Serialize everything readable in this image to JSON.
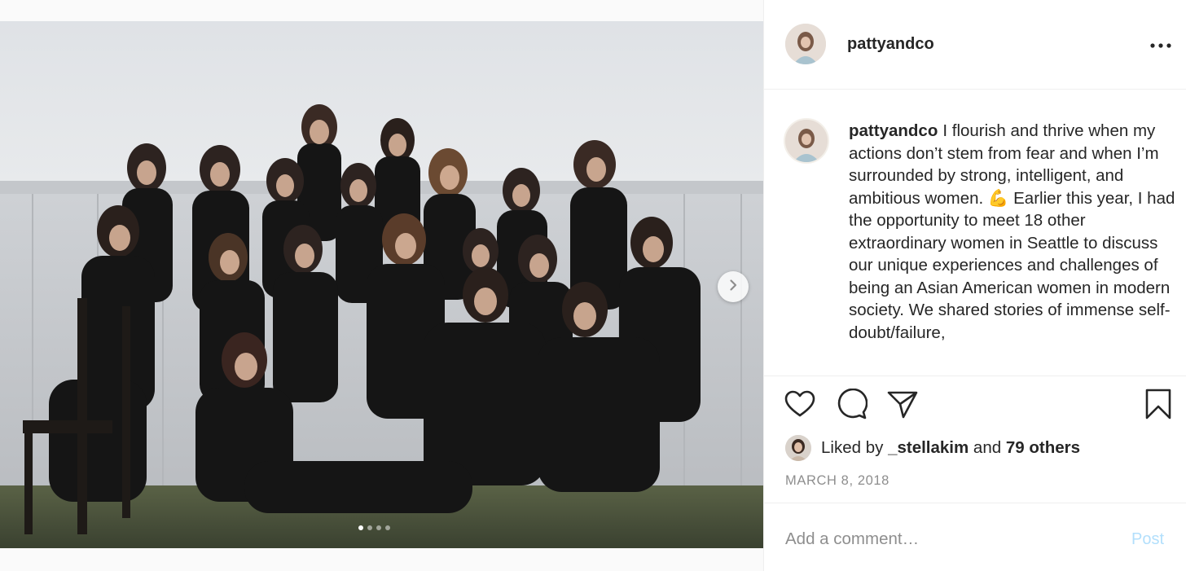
{
  "post": {
    "username": "pattyandco",
    "caption_user": "pattyandco",
    "caption": "I flourish and thrive when my actions don’t stem from fear and when I’m surrounded by strong, intelligent, and ambitious women. 💪 Earlier this year, I had the opportunity to meet 18 other extraordinary women in Seattle to discuss our unique experiences and challenges of being an Asian American women in modern society. We shared stories of immense self-doubt/failure,",
    "liked_prefix": "Liked by",
    "liked_user": "_stellakim",
    "liked_and": "and",
    "liked_others": "79 others",
    "date": "MARCH 8, 2018",
    "comment_placeholder": "Add a comment…",
    "post_label": "Post"
  },
  "carousel": {
    "slide_count": 4,
    "active_slide": 1
  },
  "icons": {
    "more": "more-options-icon",
    "like": "heart-icon",
    "comment": "comment-bubble-icon",
    "share": "paper-plane-icon",
    "save": "bookmark-icon",
    "next": "chevron-right-icon"
  },
  "colors": {
    "text": "#262626",
    "secondary": "#8e8e8e",
    "post_disabled": "#b2dffc",
    "divider": "#efefef"
  }
}
